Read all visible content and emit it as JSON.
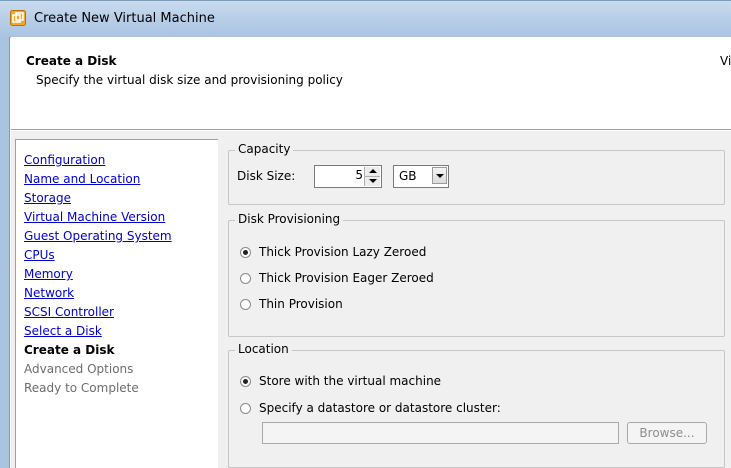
{
  "window": {
    "title": "Create New Virtual Machine"
  },
  "header": {
    "title": "Create a Disk",
    "subtitle": "Specify the virtual disk size and provisioning policy",
    "right_text": "Virt"
  },
  "steps": [
    {
      "label": "Configuration",
      "state": "done"
    },
    {
      "label": "Name and Location",
      "state": "done"
    },
    {
      "label": "Storage",
      "state": "done"
    },
    {
      "label": "Virtual Machine Version",
      "state": "done"
    },
    {
      "label": "Guest Operating System",
      "state": "done"
    },
    {
      "label": "CPUs",
      "state": "done"
    },
    {
      "label": "Memory",
      "state": "done"
    },
    {
      "label": "Network",
      "state": "done"
    },
    {
      "label": "SCSI Controller",
      "state": "done"
    },
    {
      "label": "Select a Disk",
      "state": "done"
    },
    {
      "label": "Create a Disk",
      "state": "current"
    },
    {
      "label": "Advanced Options",
      "state": "future"
    },
    {
      "label": "Ready to Complete",
      "state": "future"
    }
  ],
  "capacity": {
    "legend": "Capacity",
    "disk_size_label": "Disk Size:",
    "disk_size_value": "5",
    "unit": "GB"
  },
  "provisioning": {
    "legend": "Disk Provisioning",
    "options": [
      {
        "label": "Thick Provision Lazy Zeroed",
        "selected": true
      },
      {
        "label": "Thick Provision Eager Zeroed",
        "selected": false
      },
      {
        "label": "Thin Provision",
        "selected": false
      }
    ]
  },
  "location": {
    "legend": "Location",
    "options": [
      {
        "label": "Store with the virtual machine",
        "selected": true
      },
      {
        "label": "Specify a datastore or datastore cluster:",
        "selected": false
      }
    ],
    "datastore_value": "",
    "browse_label": "Browse..."
  },
  "colors": {
    "title_bar": "#b9cfe8",
    "link": "#0000cc",
    "disabled_text": "#6d6d6d",
    "panel_bg": "#f0f0f0"
  }
}
